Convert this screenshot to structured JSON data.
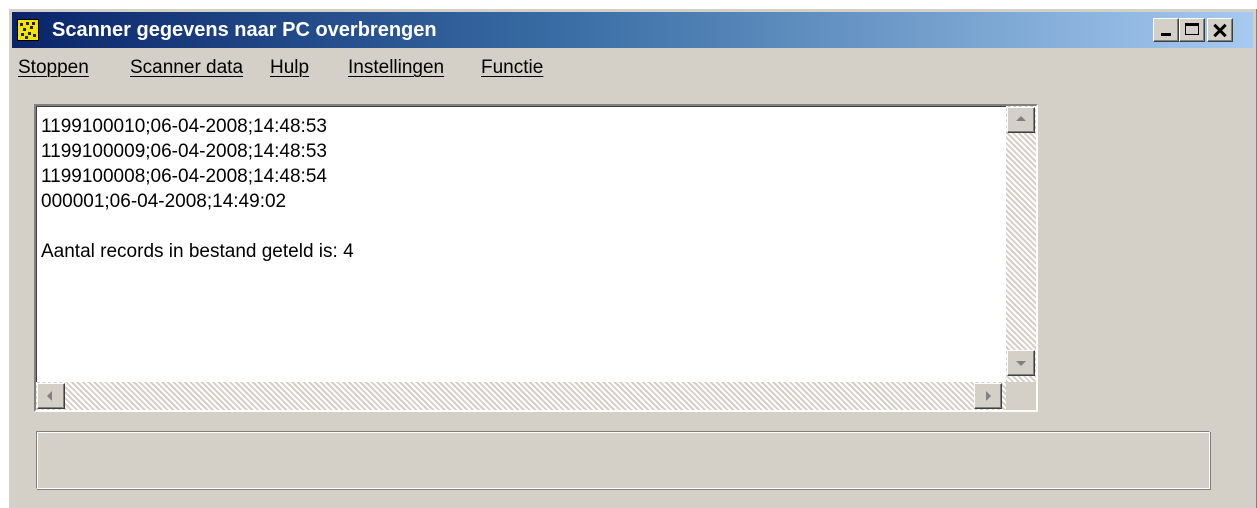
{
  "window": {
    "title": "Scanner gegevens naar PC overbrengen",
    "icon": "scanner-app-icon"
  },
  "caption_buttons": {
    "minimize": "minimize-icon",
    "maximize": "maximize-icon",
    "close": "close-icon"
  },
  "menu": {
    "items": [
      {
        "label": "Stoppen"
      },
      {
        "label": "Scanner data"
      },
      {
        "label": "Hulp"
      },
      {
        "label": "Instellingen"
      },
      {
        "label": "Functie"
      }
    ]
  },
  "output": {
    "text": "1199100010;06-04-2008;14:48:53\n1199100009;06-04-2008;14:48:53\n1199100008;06-04-2008;14:48:54\n000001;06-04-2008;14:49:02\n\nAantal records in bestand geteld is: 4"
  },
  "status": {
    "text": ""
  },
  "colors": {
    "face": "#d4d0c8",
    "title_start": "#0a246a",
    "title_end": "#a6caf0",
    "icon_bg": "#f5e400"
  }
}
